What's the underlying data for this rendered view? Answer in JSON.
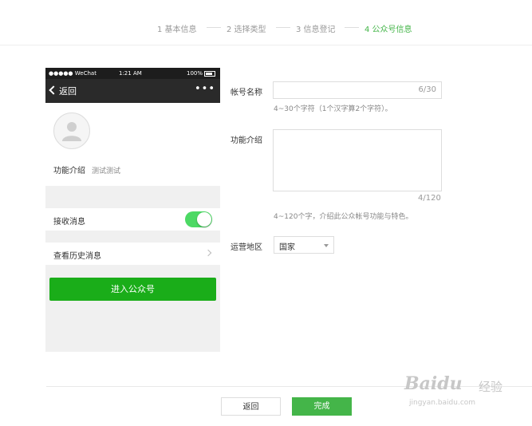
{
  "steps": [
    {
      "label": "1 基本信息"
    },
    {
      "label": "2 选择类型"
    },
    {
      "label": "3 信息登记"
    },
    {
      "label": "4 公众号信息"
    }
  ],
  "colors": {
    "accent": "#44b549",
    "switch_on": "#4cd964",
    "enter_button": "#1aad19"
  },
  "preview": {
    "status": {
      "carrier": "●●●●● WeChat",
      "time": "1:21 AM",
      "battery": "100%"
    },
    "nav": {
      "back_label": "返回",
      "more_label": "•••"
    },
    "intro_label": "功能介绍",
    "intro_value": "测试测试",
    "receive_label": "接收消息",
    "receive_on": true,
    "history_label": "查看历史消息",
    "enter_label": "进入公众号"
  },
  "form": {
    "name_label": "帐号名称",
    "name_counter": "6/30",
    "name_hint": "4~30个字符（1个汉字算2个字符）。",
    "intro_label": "功能介绍",
    "intro_counter": "4/120",
    "intro_hint": "4~120个字，介绍此公众帐号功能与特色。",
    "region_label": "运营地区",
    "region_value": "国家"
  },
  "buttons": {
    "back": "返回",
    "done": "完成"
  },
  "watermark": {
    "brand": "Baidu",
    "suffix": "经验",
    "url": "jingyan.baidu.com"
  }
}
